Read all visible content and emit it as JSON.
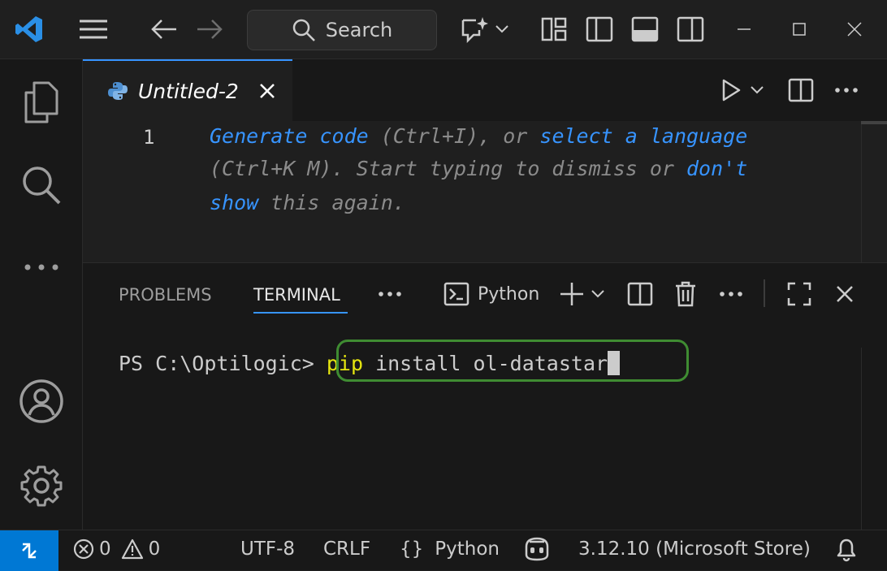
{
  "titlebar": {
    "search_label": "Search",
    "icons": [
      "vscode-logo-icon",
      "menu-icon",
      "back-arrow-icon",
      "forward-arrow-icon",
      "search-icon",
      "copilot-icon",
      "chevron-down-icon",
      "customize-layout-icon",
      "toggle-primary-sidebar-icon",
      "toggle-panel-icon",
      "toggle-secondary-sidebar-icon",
      "minimize-icon",
      "maximize-icon",
      "close-icon"
    ]
  },
  "activitybar": {
    "icons": [
      "explorer-icon",
      "search-icon",
      "more-icon",
      "accounts-icon",
      "settings-gear-icon"
    ]
  },
  "editor": {
    "tab_title": "Untitled-2",
    "line_number": "1",
    "hint": {
      "l1_link1": "Generate code",
      "l1_text1": " (Ctrl+I), or ",
      "l1_link2": "select a language",
      "l2_text": "(Ctrl+K M). Start typing to dismiss or ",
      "l2_link": "don't",
      "l3_link": "show",
      "l3_text": " this again."
    }
  },
  "panel": {
    "tabs": [
      "PROBLEMS",
      "TERMINAL"
    ],
    "active_tab": "TERMINAL",
    "terminal_profile": "Python",
    "terminal": {
      "prompt": "PS C:\\Optilogic> ",
      "cmd_keyword": "pip",
      "cmd_rest": " install ol-datastar"
    }
  },
  "statusbar": {
    "errors": "0",
    "warnings": "0",
    "encoding": "UTF-8",
    "eol": "CRLF",
    "language_braces": "{}",
    "language": "Python",
    "interpreter": "3.12.10 (Microsoft Store)"
  },
  "colors": {
    "accent": "#3794ff",
    "remote": "#0078d4",
    "highlight_border": "#3f8c32",
    "pip_keyword": "#e5e510"
  }
}
